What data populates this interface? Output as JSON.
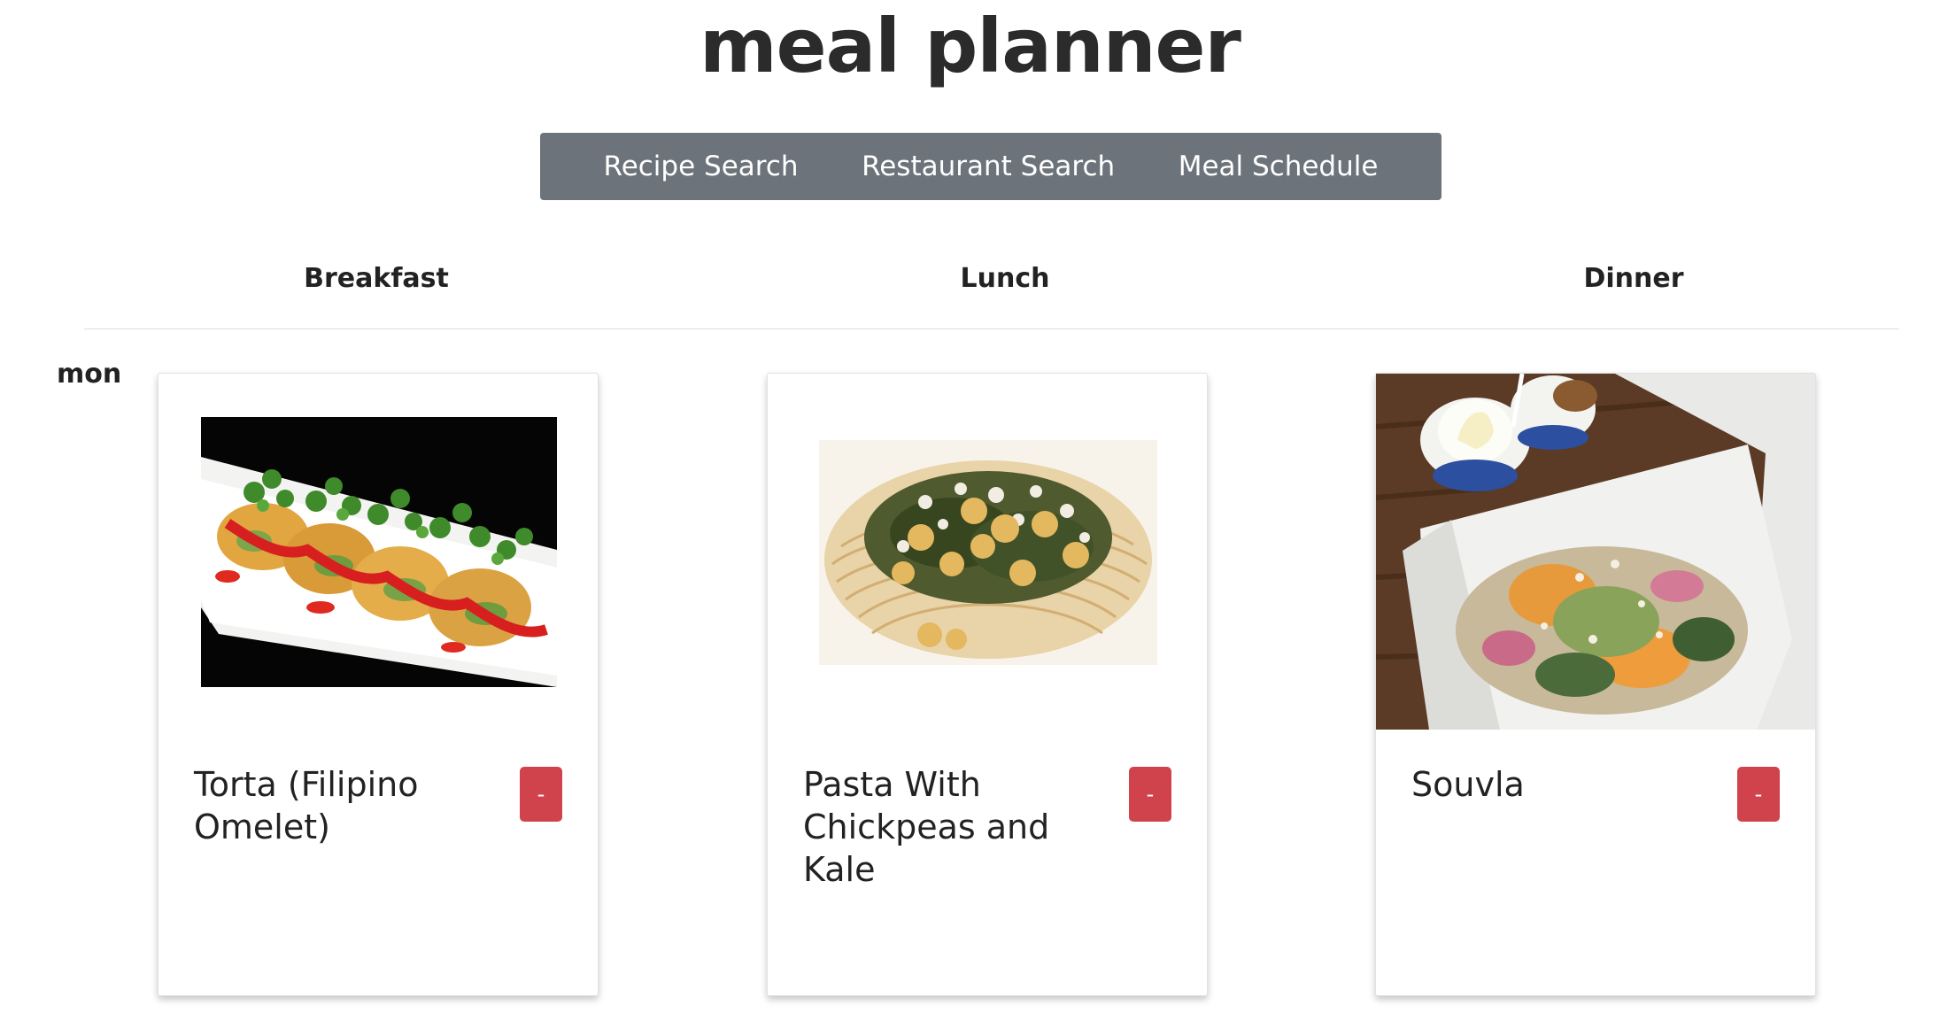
{
  "header": {
    "title": "meal planner"
  },
  "nav": {
    "items": [
      {
        "label": "Recipe Search"
      },
      {
        "label": "Restaurant Search"
      },
      {
        "label": "Meal Schedule"
      }
    ]
  },
  "schedule": {
    "columns": [
      "Breakfast",
      "Lunch",
      "Dinner"
    ],
    "days": [
      {
        "label": "mon",
        "meals": [
          {
            "title": "Torta (Filipino Omelet)",
            "image": "omelet-on-plate",
            "remove_label": "-"
          },
          {
            "title": "Pasta With Chickpeas and Kale",
            "image": "pasta-with-chickpeas",
            "remove_label": "-"
          },
          {
            "title": "Souvla",
            "image": "salad-in-takeout-box",
            "remove_label": "-"
          }
        ]
      }
    ]
  },
  "colors": {
    "nav_background": "#6c737a",
    "remove_button": "#d0434d"
  }
}
